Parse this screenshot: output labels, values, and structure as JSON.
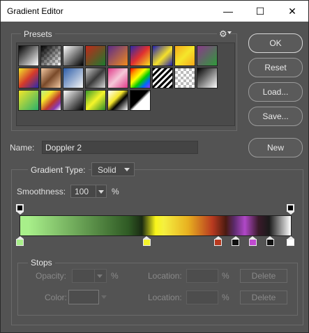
{
  "window": {
    "title": "Gradient Editor",
    "controls": {
      "minimize": "—",
      "maximize": "☐",
      "close": "✕"
    }
  },
  "presets": {
    "label": "Presets",
    "gear_icon": "⚙",
    "swatches": [
      "linear-gradient(135deg,#000 0%,#fff 100%)",
      "linear-gradient(135deg,#000 0%,rgba(0,0,0,0) 100%), repeating-conic-gradient(#bbb 0 25%,#fff 0 50%) 0 0/8px 8px",
      "linear-gradient(135deg,#fff 0%,#000 100%)",
      "linear-gradient(135deg,#c0291b 0%,#1d7a2e 100%)",
      "linear-gradient(135deg,#5b2c8a 0%,#f08a1c 100%)",
      "linear-gradient(135deg,#2a2aa8 0%,#e03030 50%,#f6e11c 100%)",
      "linear-gradient(135deg,#1e1eb0 0%,#f5e12a 55%,#1e1eb0 100%)",
      "linear-gradient(135deg,#f5a81c 0%,#f5e62a 50%,#f5a81c 100%)",
      "linear-gradient(135deg,#8a3a8a 0%,#2f9a3a 100%)",
      "linear-gradient(135deg,#f2e62a 0%,#d43a2a 50%,#2a2ab0 100%)",
      "linear-gradient(135deg,#f3c9a2 0%,#7a4a2a 50%,#f3c9a2 100%)",
      "linear-gradient(135deg,#2d5da8 0%,#f6f6f6 100%)",
      "linear-gradient(135deg,#c8c8c8 0%,#3a3a3a 50%,#d8d8d8 100%)",
      "linear-gradient(135deg,#e03a8a 0%,#f5c8d8 50%,#e03a8a 100%)",
      "linear-gradient(135deg,#ff0000,#ff9900,#ffff00,#00cc00,#0066ff,#9933ff)",
      "repeating-linear-gradient(135deg,#000 0 3px,#fff 3px 6px)",
      "repeating-conic-gradient(#bbb 0 25%,#fff 0 50%) 0 0/8px 8px",
      "linear-gradient(135deg,#000 0%,#fff 100%)",
      "linear-gradient(135deg,#f2e62a 0%,#2ab06a 100%)",
      "linear-gradient(135deg,#b8f28a 0%,#f5e62a 30%,#c0392b 60%,#8a3ab0 80%,#fff 100%)",
      "linear-gradient(135deg,#fff 0%,#000 100%)",
      "linear-gradient(135deg,#3a9a2a 0%,#f5f52a 50%,#2a8a2a 100%)",
      "linear-gradient(135deg,#fff 0%,#f5e62a 40%,#000 60%,#fff 100%)",
      "linear-gradient(135deg,#000 0%,#000 45%,#fff 55%,#fff 100%)"
    ]
  },
  "buttons": {
    "ok": "OK",
    "reset": "Reset",
    "load": "Load...",
    "save": "Save...",
    "new": "New"
  },
  "name_field": {
    "label": "Name:",
    "value": "Doppler 2"
  },
  "gradient": {
    "type_label": "Gradient Type:",
    "type_value": "Solid",
    "smoothness_label": "Smoothness:",
    "smoothness_value": "100",
    "smoothness_unit": "%",
    "bar_css": "linear-gradient(90deg,#a8ef8a 0%,#a8ef8a 3%,#2f5a24 40%,#1a2b12 45%,#f8f41a 50%,#f5f040 53%,#e8b020 62%,#b83a20 71%,#4a1a10 76%,#5a2a6a 79%,#b048c8 83%,#3a1a2a 88%,#1a1a1a 92%,#ffffff 100%)",
    "opacity_stops": [
      {
        "position": 0,
        "color": "#000000"
      },
      {
        "position": 1,
        "color": "#000000"
      }
    ],
    "color_stops": [
      {
        "position": 0,
        "color": "#a8ef8a"
      },
      {
        "position": 0.469,
        "color": "#f5f52a"
      },
      {
        "position": 0.732,
        "color": "#b83a20"
      },
      {
        "position": 0.797,
        "color": "#111111"
      },
      {
        "position": 0.86,
        "color": "#c04ad0"
      },
      {
        "position": 0.924,
        "color": "#111111"
      },
      {
        "position": 1,
        "color": "#ffffff"
      }
    ]
  },
  "stops": {
    "label": "Stops",
    "opacity_label": "Opacity:",
    "opacity_unit": "%",
    "location_label": "Location:",
    "location_unit": "%",
    "color_label": "Color:",
    "delete_label": "Delete"
  }
}
